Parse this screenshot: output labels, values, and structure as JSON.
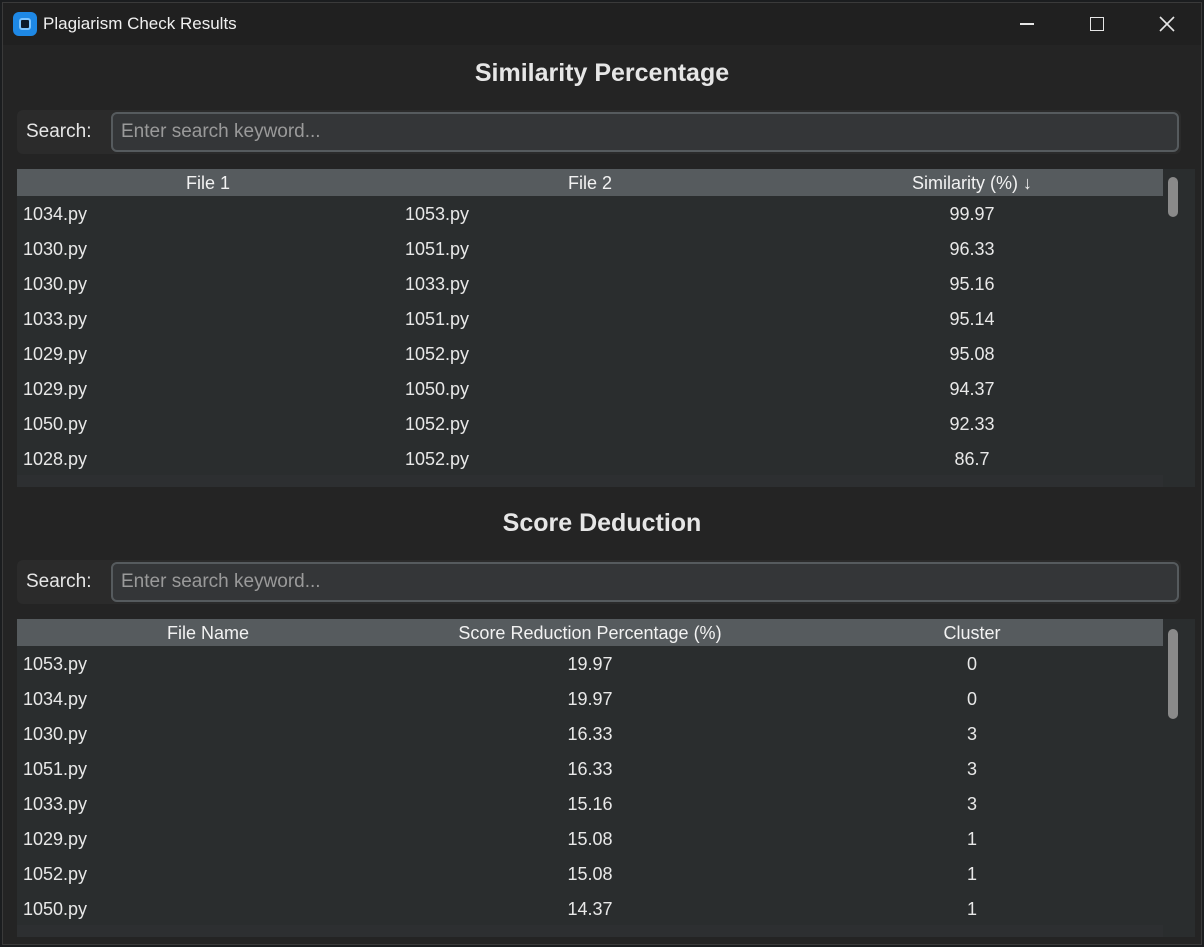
{
  "window": {
    "title": "Plagiarism Check Results",
    "icon": "app-icon"
  },
  "similarity": {
    "title": "Similarity Percentage",
    "search_label": "Search:",
    "search_placeholder": "Enter search keyword...",
    "columns": [
      "File 1",
      "File 2",
      "Similarity (%) ↓"
    ],
    "rows": [
      [
        "1034.py",
        "1053.py",
        "99.97"
      ],
      [
        "1030.py",
        "1051.py",
        "96.33"
      ],
      [
        "1030.py",
        "1033.py",
        "95.16"
      ],
      [
        "1033.py",
        "1051.py",
        "95.14"
      ],
      [
        "1029.py",
        "1052.py",
        "95.08"
      ],
      [
        "1029.py",
        "1050.py",
        "94.37"
      ],
      [
        "1050.py",
        "1052.py",
        "92.33"
      ],
      [
        "1028.py",
        "1052.py",
        "86.7"
      ]
    ]
  },
  "deduction": {
    "title": "Score Deduction",
    "search_label": "Search:",
    "search_placeholder": "Enter search keyword...",
    "columns": [
      "File Name",
      "Score Reduction Percentage (%)",
      "Cluster"
    ],
    "rows": [
      [
        "1053.py",
        "19.97",
        "0"
      ],
      [
        "1034.py",
        "19.97",
        "0"
      ],
      [
        "1030.py",
        "16.33",
        "3"
      ],
      [
        "1051.py",
        "16.33",
        "3"
      ],
      [
        "1033.py",
        "15.16",
        "3"
      ],
      [
        "1029.py",
        "15.08",
        "1"
      ],
      [
        "1052.py",
        "15.08",
        "1"
      ],
      [
        "1050.py",
        "14.37",
        "1"
      ]
    ]
  },
  "colors": {
    "window_bg": "#242424",
    "table_bg": "#2a2d2e",
    "header_bg": "#565b5e",
    "accent": "#1e88e5"
  }
}
